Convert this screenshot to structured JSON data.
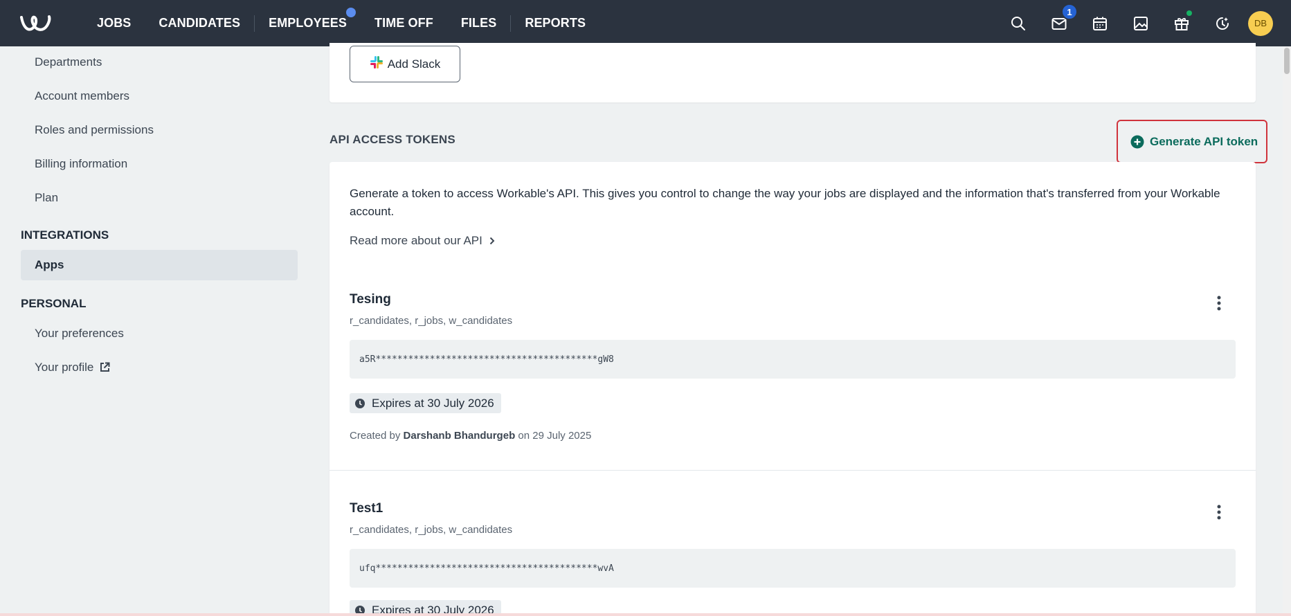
{
  "nav": {
    "items": [
      {
        "label": "JOBS"
      },
      {
        "label": "CANDIDATES"
      },
      {
        "label": "EMPLOYEES"
      },
      {
        "label": "TIME OFF"
      },
      {
        "label": "FILES"
      },
      {
        "label": "REPORTS"
      }
    ],
    "inbox_badge": "1",
    "avatar_initials": "DB",
    "colors": {
      "bar": "#2b333f",
      "badge": "#2563d4",
      "employees_dot": "#5b8def",
      "gift_dot": "#16b364",
      "avatar": "#f7cd51"
    }
  },
  "sidebar": {
    "items": [
      {
        "label": "Departments"
      },
      {
        "label": "Account members"
      },
      {
        "label": "Roles and permissions"
      },
      {
        "label": "Billing information"
      },
      {
        "label": "Plan"
      }
    ],
    "integrations_heading": "INTEGRATIONS",
    "apps_label": "Apps",
    "personal_heading": "PERSONAL",
    "preferences_label": "Your preferences",
    "profile_label": "Your profile"
  },
  "slack": {
    "button_label": "Add Slack"
  },
  "api": {
    "section_title": "API ACCESS TOKENS",
    "generate_label": "Generate API token",
    "description": "Generate a token to access Workable's API. This gives you control to change the way your jobs are displayed and the information that's transferred from your Workable account.",
    "read_more": "Read more about our API",
    "accent": "#0b6b5c",
    "highlight": "#d0333c",
    "tokens": [
      {
        "name": "Tesing",
        "scopes": "r_candidates, r_jobs, w_candidates",
        "value": "a5R*****************************************gW8",
        "expires": "Expires at 30 July 2026",
        "created_prefix": "Created by",
        "created_by": "Darshanb Bhandurgeb",
        "created_suffix": "on 29 July 2025"
      },
      {
        "name": "Test1",
        "scopes": "r_candidates, r_jobs, w_candidates",
        "value": "ufq*****************************************wvA",
        "expires": "Expires at 30 July 2026"
      }
    ]
  }
}
